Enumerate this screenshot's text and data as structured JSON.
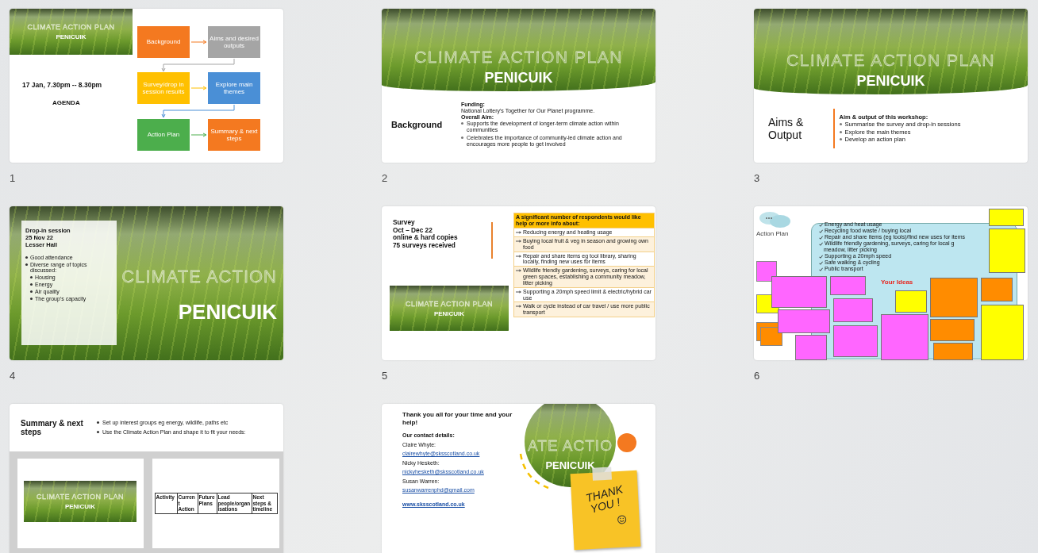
{
  "slides": [
    {
      "kind": "agenda",
      "number": "1",
      "banner": {
        "title": "CLIMATE ACTION PLAN",
        "place": "PENICUIK"
      },
      "date": "17 Jan, 7.30pm -- 8.30pm",
      "heading": "AGENDA",
      "steps": [
        {
          "label": "Background",
          "color": "#f47920"
        },
        {
          "label": "Aims and desired outputs",
          "color": "#a5a5a5"
        },
        {
          "label": "Survey/drop in session results",
          "color": "#ffc000"
        },
        {
          "label": "Explore main themes",
          "color": "#4a8fd6"
        },
        {
          "label": "Action Plan",
          "color": "#4cae4c"
        },
        {
          "label": "Summary & next steps",
          "color": "#f47920"
        }
      ]
    },
    {
      "kind": "background",
      "number": "2",
      "banner": {
        "title": "CLIMATE ACTION PLAN",
        "place": "PENICUIK"
      },
      "heading": "Background",
      "body": [
        {
          "kind": "label",
          "text": "Funding:"
        },
        {
          "kind": "text",
          "text": "National Lottery's Together for Our Planet programme."
        },
        {
          "kind": "label",
          "text": "Overall Aim:"
        },
        {
          "kind": "bullet",
          "text": "Supports the development of longer-term climate action within communities"
        },
        {
          "kind": "bullet",
          "text": "Celebrates the importance of community-led climate action and encourages more people to get involved"
        }
      ]
    },
    {
      "kind": "aims",
      "number": "3",
      "banner": {
        "title": "CLIMATE ACTION PLAN",
        "place": "PENICUIK"
      },
      "heading": "Aims & Output",
      "body": [
        {
          "kind": "label",
          "text": "Aim & output of this workshop:"
        },
        {
          "kind": "bullet",
          "text": "Summarise the survey and drop-in sessions"
        },
        {
          "kind": "bullet",
          "text": "Explore the main themes"
        },
        {
          "kind": "bullet",
          "text": "Develop an action plan"
        }
      ]
    },
    {
      "kind": "dropin",
      "number": "4",
      "banner": {
        "title": "CLIMATE ACTION",
        "place": "PENICUIK"
      },
      "heading": [
        "Drop-in session",
        "25 Nov 22",
        "Lesser Hall"
      ],
      "points": [
        {
          "text": "Good attendance"
        },
        {
          "text": "Diverse range of topics discussed:",
          "children": [
            {
              "text": "Housing"
            },
            {
              "text": "Energy"
            },
            {
              "text": "Air quality"
            },
            {
              "text": "The group's capacity"
            }
          ]
        }
      ]
    },
    {
      "kind": "survey",
      "number": "5",
      "banner": {
        "title": "CLIMATE ACTION PLAN",
        "place": "PENICUIK"
      },
      "heading": [
        "Survey",
        "Oct – Dec 22",
        "online & hard copies",
        "75 surveys received"
      ],
      "table_header": "A significant number of respondents would like help or more info about:",
      "rows": [
        "Reducing energy and heating usage",
        "Buying local fruit & veg in season and growing own food",
        "Repair and share items eg tool library, sharing locally, finding new uses for items",
        "Wildlife friendly gardening, surveys, caring for local green spaces, establishing a community meadow, litter picking",
        "Supporting a 20mph speed limit & electric/hybrid car use",
        "Walk or cycle instead of car travel / use more public transport"
      ]
    },
    {
      "kind": "ideas",
      "number": "6",
      "title": "Action Plan",
      "checklist": [
        "Energy and heat usage",
        "Recycling food waste / buying local",
        "Repair and share items (eg tools)/find new uses for items",
        "Wildlife friendly gardening, surveys, caring for local g",
        "meadow, litter picking",
        "Supporting a 20mph speed",
        "Safe walking & cycling",
        "Public transport"
      ],
      "ideas_label": "Your Ideas",
      "notes": [
        {
          "color": "#ffff00"
        },
        {
          "color": "#ffff00"
        },
        {
          "color": "#ffff00"
        },
        {
          "color": "#ff8c00"
        },
        {
          "color": "#ff8c00"
        },
        {
          "color": "#ff8c00"
        },
        {
          "color": "#ff8c00"
        },
        {
          "color": "#ffff00"
        },
        {
          "color": "#ff66ff"
        },
        {
          "color": "#ff66ff"
        },
        {
          "color": "#ff66ff"
        },
        {
          "color": "#ff66ff"
        },
        {
          "color": "#ff66ff"
        },
        {
          "color": "#ff66ff"
        },
        {
          "color": "#ff66ff"
        }
      ]
    },
    {
      "kind": "summary",
      "heading": "Summary & next steps",
      "bullets": [
        "Set up interest groups eg energy, wildlife, paths etc",
        "Use the Climate Action Plan and shape it to fit your needs:"
      ],
      "banner": {
        "title": "CLIMATE ACTION PLAN",
        "place": "PENICUIK"
      },
      "columns": [
        "Activity",
        "Current Action",
        "Future Plans",
        "Lead people/organisations",
        "Next steps & timeline"
      ]
    },
    {
      "kind": "thanks",
      "heading": "Thank you all for your time and your help!",
      "contacts_label": "Our contact details:",
      "contacts": [
        {
          "name": "Claire Whyte:",
          "email": "clairewhyte@sksscotland.co.uk"
        },
        {
          "name": "Nicky Hesketh:",
          "email": "nickyhesketh@sksscotland.co.uk"
        },
        {
          "name": "Susan Warren:",
          "email": "susanwarrenphd@gmail.com"
        }
      ],
      "website": "www.sksscotland.co.uk",
      "banner": {
        "title": "ATE ACTIO",
        "place": "PENICUIK"
      },
      "note": [
        "THANK",
        "YOU !"
      ]
    }
  ]
}
